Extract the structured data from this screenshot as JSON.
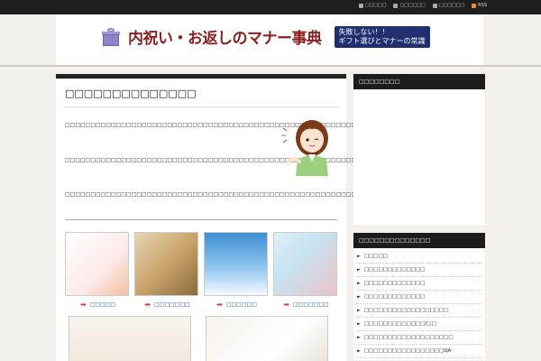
{
  "toplinks": [
    {
      "icon": "person-icon",
      "label": "□□□□□"
    },
    {
      "icon": "page-icon",
      "label": "□□□□□□"
    },
    {
      "icon": "mail-icon",
      "label": "□□□□□□"
    },
    {
      "icon": "rss-icon",
      "label": "RSS"
    }
  ],
  "header": {
    "title": "内祝い・お返しのマナー事典",
    "badge_line1": "失敗しない！！",
    "badge_line2": "ギフト選びとマナーの常識"
  },
  "main": {
    "heading": "□□□□□□□□□□□□□□",
    "para1": "□□□□□□□□□□□□□□□□□□□□□□□□□□□□□□□□□□□□□□□□□□□□□□□□□□□□□□□□□□□□□□□□□□□□□□□",
    "para2": "□□□□□□□□□□□□□□□□□□□□□□□□□□□□□□□□□□□□□□□□□□□□□□□□□□□□□□□□□□□□□□□□□□□",
    "para3": "□□□□□□□□□□□□□□□□□□□□□□□□□□□□□□□□□□□□□□□□□□□□□□□□□□□□□□□□□□□□□□□□□□□□□□□□□□",
    "thumbs": [
      {
        "label": "□□□□□"
      },
      {
        "label": "□□□□□□□"
      },
      {
        "label": "□□□□□□"
      },
      {
        "label": "□□□□□□□"
      }
    ]
  },
  "sidebar": {
    "box1_title": "□□□□□□□□",
    "box2_title": "□□□□□□□□□□□□□□",
    "items": [
      "□□□□□",
      "□□□□□□□□□□□□□",
      "□□□□□□□□□□□□□",
      "□□□□□□□□□□□□□",
      "□□□□□□□□□□□□□□□□□□",
      "□□□□□□□□□□□□□/□□",
      "□□□□□□□□□□□□□□□□□□□",
      "□□□□□□□□□□□□□□□□□QA"
    ]
  }
}
